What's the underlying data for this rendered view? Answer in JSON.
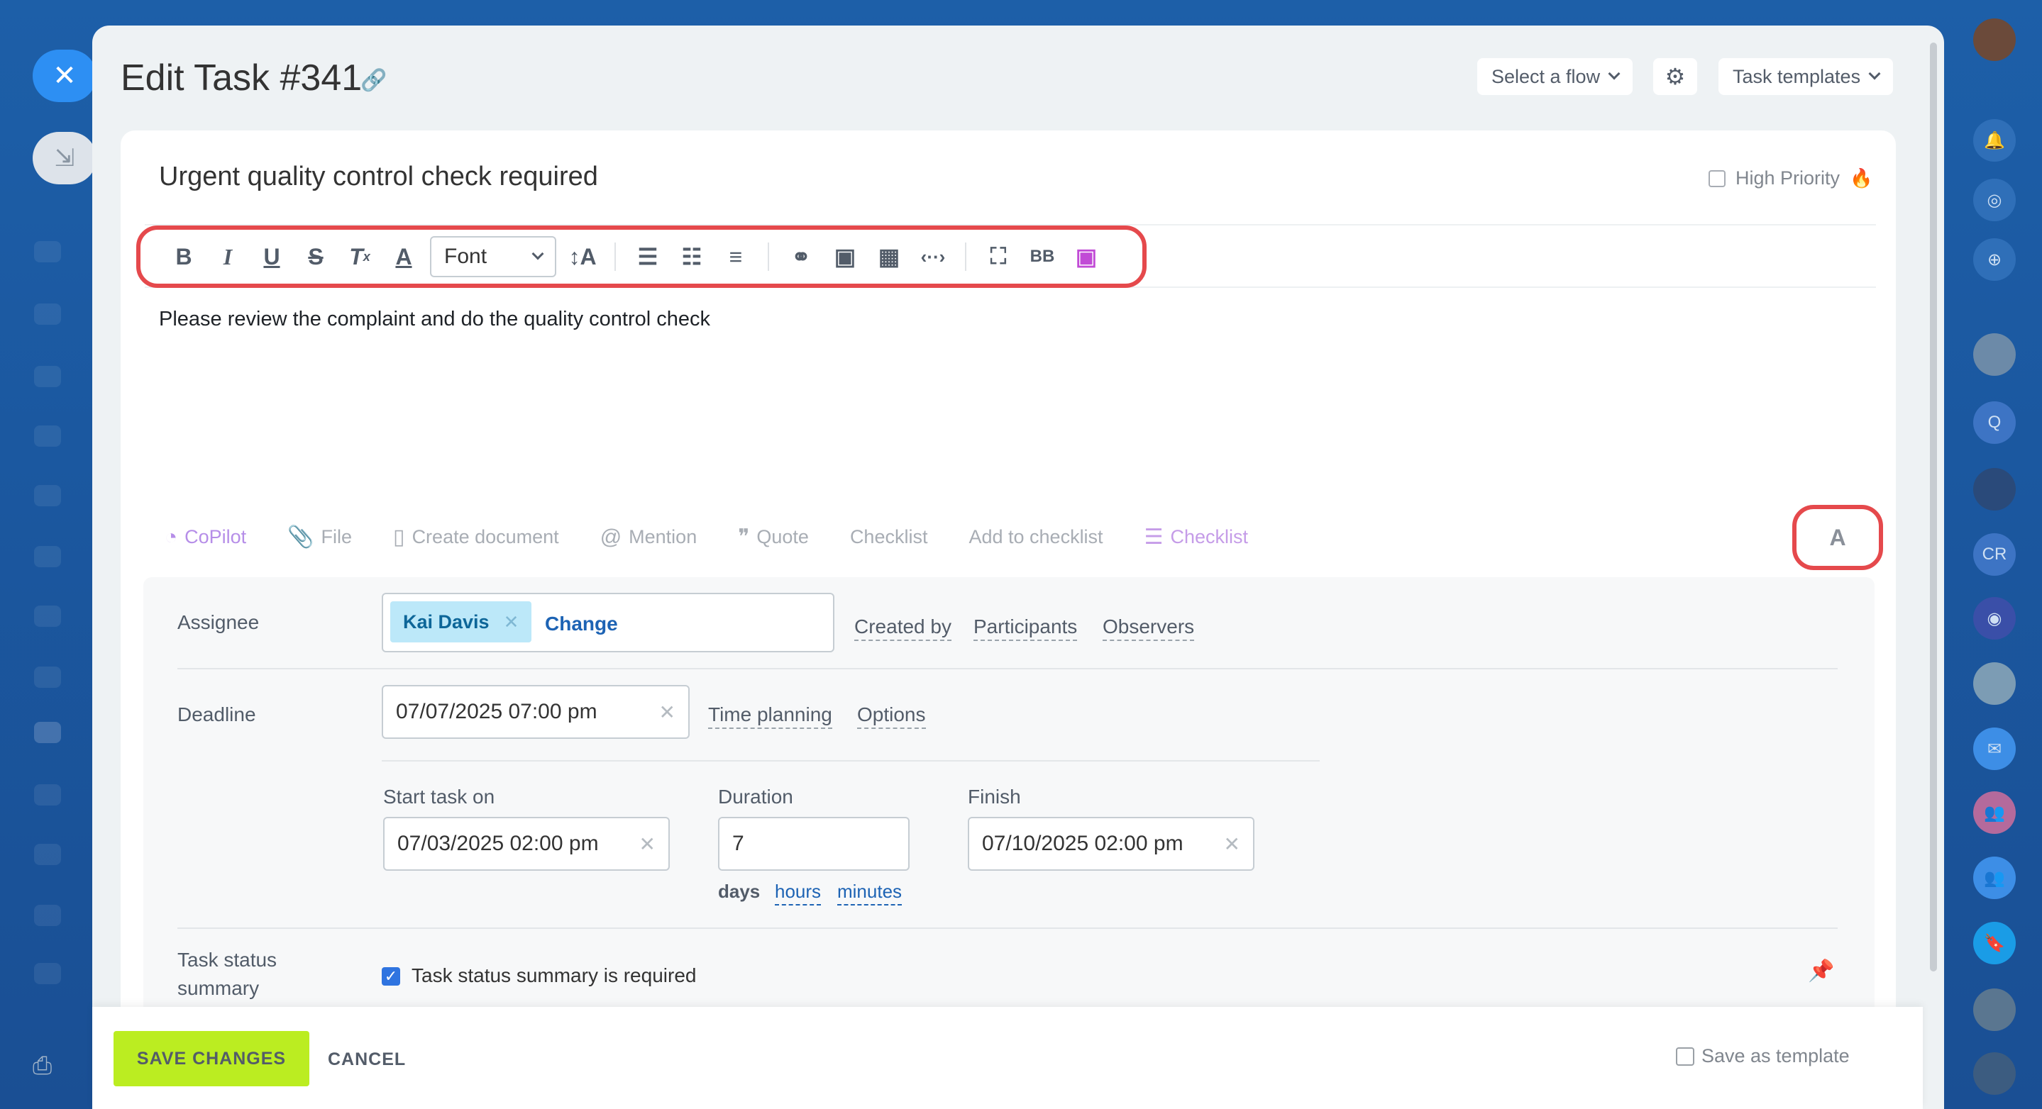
{
  "window": {
    "title": "Edit Task #341"
  },
  "header": {
    "flow_label": "Select a flow",
    "templates_label": "Task templates"
  },
  "task": {
    "title": "Urgent quality control check required",
    "high_priority_label": "High Priority",
    "description": "Please review the complaint and do the quality control check"
  },
  "toolbar": {
    "font_label": "Font",
    "icons": [
      "bold-icon",
      "italic-icon",
      "underline-icon",
      "strikethrough-icon",
      "clear-format-icon",
      "font-color-icon",
      "font-size-icon",
      "numbered-list-icon",
      "bulleted-list-icon",
      "align-icon",
      "link-icon",
      "image-icon",
      "table-icon",
      "code-icon",
      "fullscreen-icon",
      "bbcode-icon",
      "ai-image-icon"
    ]
  },
  "actions": {
    "copilot": "CoPilot",
    "file": "File",
    "create_document": "Create document",
    "mention": "Mention",
    "quote": "Quote",
    "checklist": "Checklist",
    "add_to_checklist": "Add to checklist",
    "checklist2": "Checklist",
    "format_button": "A"
  },
  "form": {
    "assignee_label": "Assignee",
    "assignee_name": "Kai Davis",
    "change_label": "Change",
    "created_by": "Created by",
    "participants": "Participants",
    "observers": "Observers",
    "deadline_label": "Deadline",
    "deadline_value": "07/07/2025 07:00 pm",
    "time_planning": "Time planning",
    "options": "Options",
    "start_label": "Start task on",
    "start_value": "07/03/2025 02:00 pm",
    "duration_label": "Duration",
    "duration_value": "7",
    "unit_days": "days",
    "unit_hours": "hours",
    "unit_minutes": "minutes",
    "finish_label": "Finish",
    "finish_value": "07/10/2025 02:00 pm",
    "status_summary_label_1": "Task status",
    "status_summary_label_2": "summary",
    "status_summary_checkbox": "Task status summary is required",
    "status_summary_checked": true
  },
  "footer": {
    "save": "SAVE CHANGES",
    "cancel": "CANCEL",
    "save_template": "Save as template"
  },
  "right_sidebar": {
    "items": [
      "user-avatar",
      "notifications-icon",
      "target-icon",
      "chat-search-icon",
      "group-avatar",
      "Q",
      "user-avatar-2",
      "CR",
      "copilot-icon",
      "user-avatar-3",
      "mail-icon",
      "group-icon",
      "group-icon-2",
      "bookmark-icon",
      "user-avatar-4",
      "user-avatar-5"
    ]
  },
  "colors": {
    "accent": "#2d8ff3",
    "save_green": "#bbed21",
    "highlight_red": "#e5494c",
    "tag_blue": "#bce8f9",
    "copilot_purple": "#b68ee8"
  }
}
